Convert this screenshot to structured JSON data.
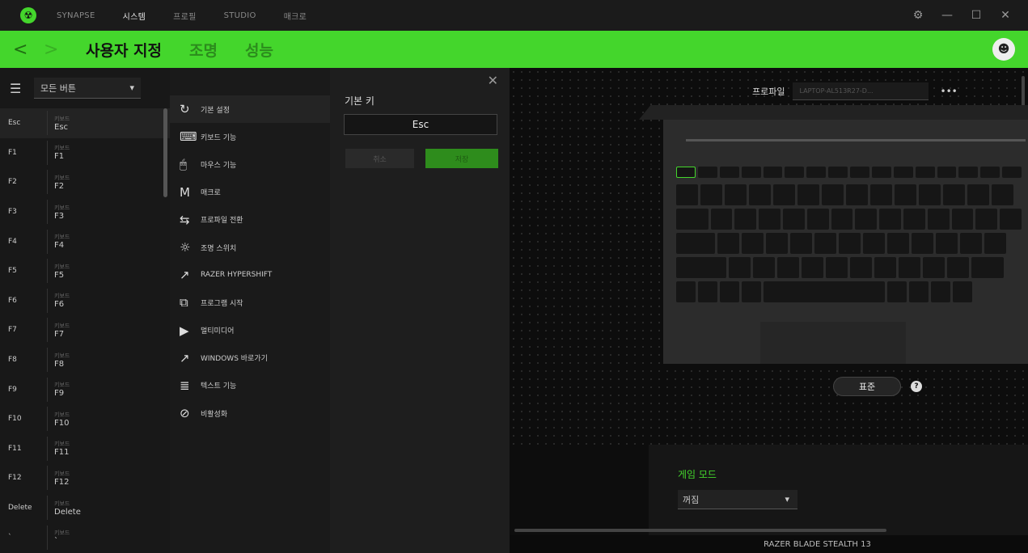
{
  "titlebar": {
    "nav": [
      "SYNAPSE",
      "시스템",
      "프로필",
      "STUDIO",
      "매크로"
    ],
    "active_index": 1,
    "controls": [
      "⚙",
      "—",
      "☐",
      "✕"
    ]
  },
  "greenbar": {
    "back": "<",
    "forward": ">",
    "tabs": [
      "사용자 지정",
      "조명",
      "성능"
    ]
  },
  "keylist": {
    "dropdown": "모든 버튼",
    "rows": [
      {
        "key": "Esc",
        "cat": "키보드",
        "fn": "Esc"
      },
      {
        "key": "F1",
        "cat": "키보드",
        "fn": "F1"
      },
      {
        "key": "F2",
        "cat": "키보드",
        "fn": "F2"
      },
      {
        "key": "F3",
        "cat": "키보드",
        "fn": "F3"
      },
      {
        "key": "F4",
        "cat": "키보드",
        "fn": "F4"
      },
      {
        "key": "F5",
        "cat": "키보드",
        "fn": "F5"
      },
      {
        "key": "F6",
        "cat": "키보드",
        "fn": "F6"
      },
      {
        "key": "F7",
        "cat": "키보드",
        "fn": "F7"
      },
      {
        "key": "F8",
        "cat": "키보드",
        "fn": "F8"
      },
      {
        "key": "F9",
        "cat": "키보드",
        "fn": "F9"
      },
      {
        "key": "F10",
        "cat": "키보드",
        "fn": "F10"
      },
      {
        "key": "F11",
        "cat": "키보드",
        "fn": "F11"
      },
      {
        "key": "F12",
        "cat": "키보드",
        "fn": "F12"
      },
      {
        "key": "Delete",
        "cat": "키보드",
        "fn": "Delete"
      },
      {
        "key": "`",
        "cat": "키보드",
        "fn": "`"
      }
    ]
  },
  "funcmenu": [
    {
      "icon": "↻",
      "icon_name": "reset-icon",
      "label": "기본 설정"
    },
    {
      "icon": "⌨",
      "icon_name": "keyboard-icon",
      "label": "키보드 기능"
    },
    {
      "icon": "🖱",
      "icon_name": "mouse-icon",
      "label": "마우스 기능"
    },
    {
      "icon": "M",
      "icon_name": "macro-icon",
      "label": "매크로"
    },
    {
      "icon": "⇆",
      "icon_name": "profile-switch-icon",
      "label": "프로파일 전환"
    },
    {
      "icon": "☼",
      "icon_name": "lighting-icon",
      "label": "조명 스위치"
    },
    {
      "icon": "↗",
      "icon_name": "hypershift-icon",
      "label": "RAZER HYPERSHIFT"
    },
    {
      "icon": "⧉",
      "icon_name": "launch-program-icon",
      "label": "프로그램 시작"
    },
    {
      "icon": "▶",
      "icon_name": "multimedia-icon",
      "label": "멀티미디어"
    },
    {
      "icon": "↗",
      "icon_name": "windows-shortcut-icon",
      "label": "WINDOWS 바로가기"
    },
    {
      "icon": "≣",
      "icon_name": "text-function-icon",
      "label": "텍스트 기능"
    },
    {
      "icon": "⊘",
      "icon_name": "disable-icon",
      "label": "비활성화"
    }
  ],
  "detail": {
    "close": "✕",
    "label": "기본 키",
    "value": "Esc",
    "cancel": "취소",
    "save": "저장"
  },
  "device": {
    "profile_label": "프로파일",
    "profile_value": "LAPTOP-AL513R27-D...",
    "more": "•••",
    "standard": "표준",
    "help": "?",
    "game_mode_title": "게임 모드",
    "game_mode_value": "꺼짐",
    "device_name": "RAZER BLADE STEALTH 13"
  },
  "colors": {
    "accent": "#44d62c",
    "background": "#111111"
  }
}
